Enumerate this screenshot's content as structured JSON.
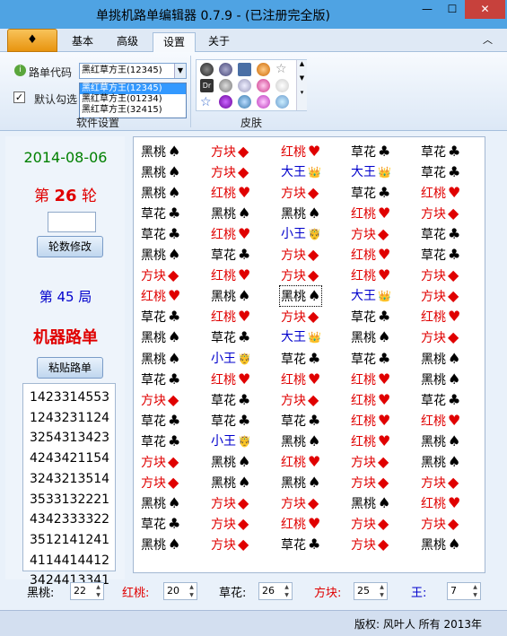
{
  "window": {
    "title": "单挑机路单编辑器 0.7.9 - (已注册完全版)"
  },
  "tabs": [
    "基本",
    "高级",
    "设置",
    "关于"
  ],
  "ribbon": {
    "route_code_label": "路单代码",
    "route_code_value": "黑红草方王(12345)",
    "route_code_options": [
      "黑红草方王(12345)",
      "黑红草方王(01234)",
      "黑红草方王(32415)"
    ],
    "default_check_label": "默认勾选",
    "software_settings_label": "软件设置",
    "skin_label": "皮肤"
  },
  "left": {
    "date": "2014-08-06",
    "round_prefix": "第",
    "round_number": "26",
    "round_suffix": "轮",
    "modify_button": "轮数修改",
    "games_text": "第 45 局",
    "robot_title": "机器路单",
    "paste_button": "粘贴路单",
    "numbers": [
      "1423314553",
      "1243231124",
      "3254313423",
      "4243421154",
      "3243213514",
      "3533132221",
      "4342333322",
      "3512141241",
      "4114414412",
      "3424413341"
    ]
  },
  "board": {
    "rows": [
      [
        [
          "黑桃",
          "♠",
          "black"
        ],
        [
          "方块",
          "◆",
          "red"
        ],
        [
          "红桃",
          "♥",
          "red"
        ],
        [
          "草花",
          "♣",
          "black"
        ],
        [
          "草花",
          "♣",
          "black"
        ]
      ],
      [
        [
          "黑桃",
          "♠",
          "black"
        ],
        [
          "方块",
          "◆",
          "red"
        ],
        [
          "大王",
          "👑",
          "blue"
        ],
        [
          "大王",
          "👑",
          "blue"
        ],
        [
          "草花",
          "♣",
          "black"
        ]
      ],
      [
        [
          "黑桃",
          "♠",
          "black"
        ],
        [
          "红桃",
          "♥",
          "red"
        ],
        [
          "方块",
          "◆",
          "red"
        ],
        [
          "草花",
          "♣",
          "black"
        ],
        [
          "红桃",
          "♥",
          "red"
        ]
      ],
      [
        [
          "草花",
          "♣",
          "black"
        ],
        [
          "黑桃",
          "♠",
          "black"
        ],
        [
          "黑桃",
          "♠",
          "black"
        ],
        [
          "红桃",
          "♥",
          "red"
        ],
        [
          "方块",
          "◆",
          "red"
        ]
      ],
      [
        [
          "草花",
          "♣",
          "black"
        ],
        [
          "红桃",
          "♥",
          "red"
        ],
        [
          "小王",
          "🤴",
          "blue"
        ],
        [
          "方块",
          "◆",
          "red"
        ],
        [
          "草花",
          "♣",
          "black"
        ]
      ],
      [
        [
          "黑桃",
          "♠",
          "black"
        ],
        [
          "草花",
          "♣",
          "black"
        ],
        [
          "方块",
          "◆",
          "red"
        ],
        [
          "红桃",
          "♥",
          "red"
        ],
        [
          "草花",
          "♣",
          "black"
        ]
      ],
      [
        [
          "方块",
          "◆",
          "red"
        ],
        [
          "红桃",
          "♥",
          "red"
        ],
        [
          "方块",
          "◆",
          "red"
        ],
        [
          "红桃",
          "♥",
          "red"
        ],
        [
          "方块",
          "◆",
          "red"
        ]
      ],
      [
        [
          "红桃",
          "♥",
          "red"
        ],
        [
          "黑桃",
          "♠",
          "black"
        ],
        [
          "黑桃",
          "♠",
          "black"
        ],
        [
          "大王",
          "👑",
          "blue"
        ],
        [
          "方块",
          "◆",
          "red"
        ]
      ],
      [
        [
          "草花",
          "♣",
          "black"
        ],
        [
          "红桃",
          "♥",
          "red"
        ],
        [
          "方块",
          "◆",
          "red"
        ],
        [
          "草花",
          "♣",
          "black"
        ],
        [
          "红桃",
          "♥",
          "red"
        ]
      ],
      [
        [
          "黑桃",
          "♠",
          "black"
        ],
        [
          "草花",
          "♣",
          "black"
        ],
        [
          "大王",
          "👑",
          "blue"
        ],
        [
          "黑桃",
          "♠",
          "black"
        ],
        [
          "方块",
          "◆",
          "red"
        ]
      ],
      [
        [
          "黑桃",
          "♠",
          "black"
        ],
        [
          "小王",
          "🤴",
          "blue"
        ],
        [
          "草花",
          "♣",
          "black"
        ],
        [
          "草花",
          "♣",
          "black"
        ],
        [
          "黑桃",
          "♠",
          "black"
        ]
      ],
      [
        [
          "草花",
          "♣",
          "black"
        ],
        [
          "红桃",
          "♥",
          "red"
        ],
        [
          "红桃",
          "♥",
          "red"
        ],
        [
          "红桃",
          "♥",
          "red"
        ],
        [
          "黑桃",
          "♠",
          "black"
        ]
      ],
      [
        [
          "方块",
          "◆",
          "red"
        ],
        [
          "草花",
          "♣",
          "black"
        ],
        [
          "方块",
          "◆",
          "red"
        ],
        [
          "红桃",
          "♥",
          "red"
        ],
        [
          "草花",
          "♣",
          "black"
        ]
      ],
      [
        [
          "草花",
          "♣",
          "black"
        ],
        [
          "草花",
          "♣",
          "black"
        ],
        [
          "草花",
          "♣",
          "black"
        ],
        [
          "红桃",
          "♥",
          "red"
        ],
        [
          "红桃",
          "♥",
          "red"
        ]
      ],
      [
        [
          "草花",
          "♣",
          "black"
        ],
        [
          "小王",
          "🤴",
          "blue"
        ],
        [
          "黑桃",
          "♠",
          "black"
        ],
        [
          "红桃",
          "♥",
          "red"
        ],
        [
          "黑桃",
          "♠",
          "black"
        ]
      ],
      [
        [
          "方块",
          "◆",
          "red"
        ],
        [
          "黑桃",
          "♠",
          "black"
        ],
        [
          "红桃",
          "♥",
          "red"
        ],
        [
          "方块",
          "◆",
          "red"
        ],
        [
          "黑桃",
          "♠",
          "black"
        ]
      ],
      [
        [
          "方块",
          "◆",
          "red"
        ],
        [
          "黑桃",
          "♠",
          "black"
        ],
        [
          "黑桃",
          "♠",
          "black"
        ],
        [
          "方块",
          "◆",
          "red"
        ],
        [
          "方块",
          "◆",
          "red"
        ]
      ],
      [
        [
          "黑桃",
          "♠",
          "black"
        ],
        [
          "方块",
          "◆",
          "red"
        ],
        [
          "方块",
          "◆",
          "red"
        ],
        [
          "黑桃",
          "♠",
          "black"
        ],
        [
          "红桃",
          "♥",
          "red"
        ]
      ],
      [
        [
          "草花",
          "♣",
          "black"
        ],
        [
          "方块",
          "◆",
          "red"
        ],
        [
          "红桃",
          "♥",
          "red"
        ],
        [
          "方块",
          "◆",
          "red"
        ],
        [
          "方块",
          "◆",
          "red"
        ]
      ],
      [
        [
          "黑桃",
          "♠",
          "black"
        ],
        [
          "方块",
          "◆",
          "red"
        ],
        [
          "草花",
          "♣",
          "black"
        ],
        [
          "方块",
          "◆",
          "red"
        ],
        [
          "黑桃",
          "♠",
          "black"
        ]
      ]
    ]
  },
  "counts": {
    "spade_label": "黑桃:",
    "spade_value": "22",
    "heart_label": "红桃:",
    "heart_value": "20",
    "club_label": "草花:",
    "club_value": "26",
    "diamond_label": "方块:",
    "diamond_value": "25",
    "king_label": "王:",
    "king_value": "7"
  },
  "status": {
    "copyright": "版权: 风叶人 所有 2013年"
  },
  "colors": {
    "black": "#000000",
    "red": "#e00000",
    "blue": "#0000cc",
    "green": "#008000"
  }
}
